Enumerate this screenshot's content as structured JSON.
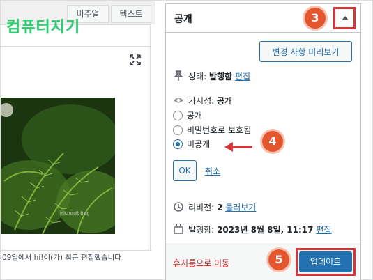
{
  "editor": {
    "tabs": [
      "비주얼",
      "텍스트"
    ],
    "logo_text": "컴퓨터지기",
    "image_watermark": "Microsoft Bing",
    "status_text": "09일에서 hi!이(가) 최근 편집했습니다"
  },
  "publish": {
    "title": "공개",
    "preview_label": "변경 사항 미리보기",
    "status_label": "상태:",
    "status_value": "발행함",
    "edit_label": "편집",
    "visibility_label": "가시성:",
    "visibility_value": "공개",
    "options": [
      "공개",
      "비밀번호로 보호됨",
      "비공개"
    ],
    "selected_option": "비공개",
    "ok_label": "OK",
    "cancel_label": "취소",
    "revisions_label": "리비전:",
    "revisions_count": "2",
    "revisions_link": "둘러보기",
    "published_label": "발행함:",
    "published_value": "2023년 8월 8일, 11:17",
    "published_edit": "편집",
    "trash_label": "휴지통으로 이동",
    "update_label": "업데이트"
  },
  "badges": [
    "3",
    "4",
    "5"
  ],
  "colors": {
    "accent": "#2271b1",
    "highlight": "#d63638",
    "badge": "#e4572e",
    "logo": "#2ecc71"
  }
}
